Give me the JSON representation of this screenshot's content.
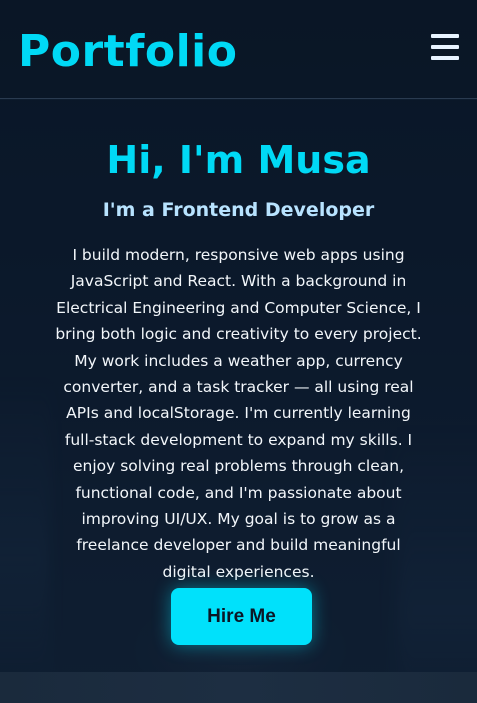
{
  "header": {
    "logo": "Portfolio",
    "menu_icon": "hamburger-menu-icon"
  },
  "hero": {
    "title": "Hi, I'm Musa",
    "subtitle": "I'm a Frontend Developer",
    "bio": "I build modern, responsive web apps using JavaScript and React. With a background in Electrical Engineering and Computer Science, I bring both logic and creativity to every project. My work includes a weather app, currency converter, and a task tracker — all using real APIs and localStorage. I'm currently learning full-stack development to expand my skills. I enjoy solving real problems through clean, functional code, and I'm passionate about improving UI/UX. My goal is to grow as a freelance developer and build meaningful digital experiences.",
    "cta_label": "Hire Me"
  },
  "colors": {
    "accent": "#00d9f5",
    "background": "#0c1a2c",
    "subtitle": "#b8e3ff",
    "text": "#f2f6fa"
  }
}
